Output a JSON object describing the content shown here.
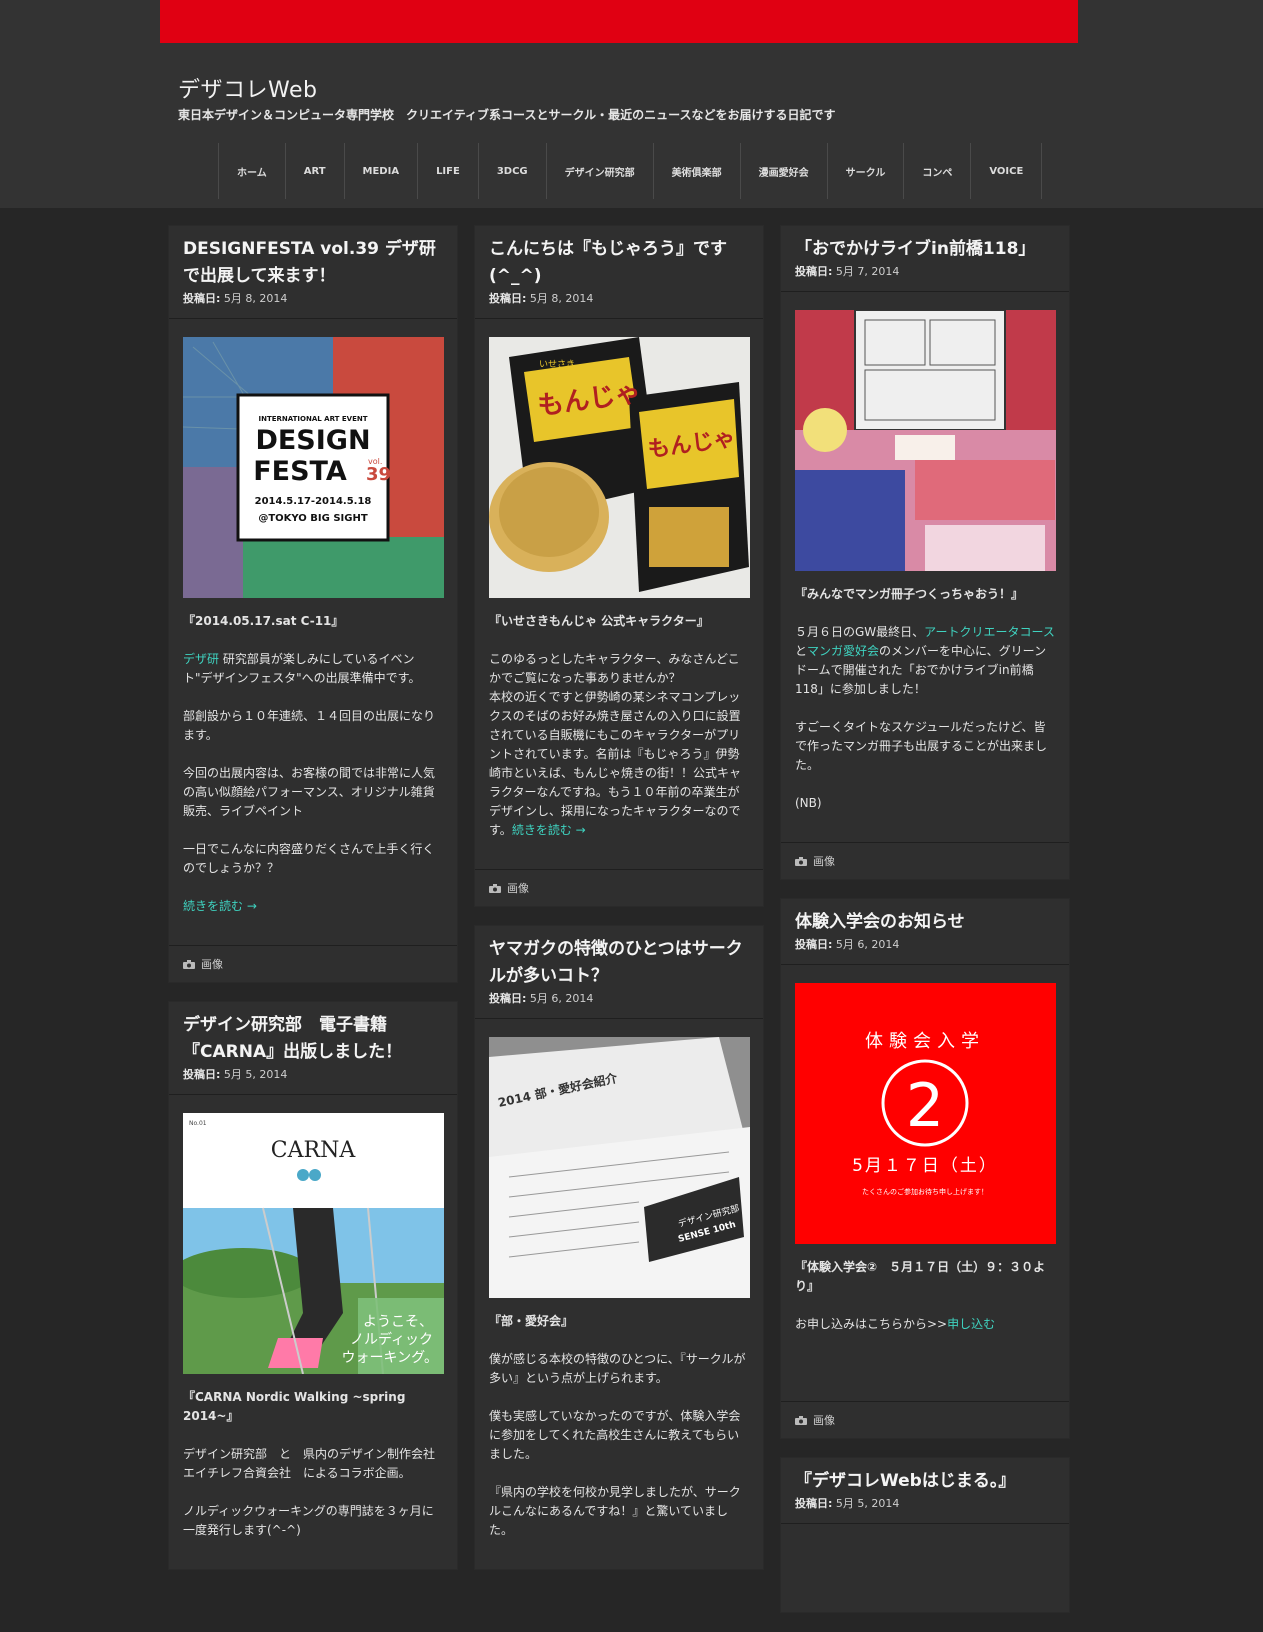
{
  "header": {
    "site_title": "デザコレWeb",
    "site_description": "東日本デザイン＆コンピュータ専門学校　クリエイティブ系コースとサークル・最近のニュースなどをお届けする日記です",
    "nav": [
      "ホーム",
      "ART",
      "MEDIA",
      "LIFE",
      "3DCG",
      "デザイン研究部",
      "美術俱楽部",
      "漫画愛好会",
      "サークル",
      "コンペ",
      "VOICE"
    ],
    "accent": "#e00012"
  },
  "labels": {
    "posted": "投稿日:",
    "format": "画像",
    "read_more": "続きを読む →"
  },
  "posts": {
    "p1": {
      "title": "DESIGNFESTA vol.39 デザ研で出展して来ます！",
      "date": "5月 8, 2014",
      "image_texts": [
        "INTERNATIONAL ART EVENT",
        "DESIGN",
        "FESTA",
        "vol.",
        "39",
        "2014.5.17-2014.5.18",
        "@TOKYO BIG SIGHT"
      ],
      "lead": "『2014.05.17.sat C-11』",
      "link_inline": "デザ研",
      "para1": " 研究部員が楽しみにしているイベント\"デザインフェスタ\"への出展準備中です。",
      "para2": "部創設から１０年連続、１４回目の出展になります。",
      "para3": "今回の出展内容は、お客様の間では非常に人気の高い似顔絵パフォーマンス、オリジナル雑貨販売、ライブペイント",
      "para4": "一日でこんなに内容盛りだくさんで上手く行くのでしょうか？？"
    },
    "p2": {
      "title": "デザイン研究部　電子書籍『CARNA』出版しました！",
      "date": "5月 5, 2014",
      "image_texts": [
        "CARNA",
        "No.01",
        "ようこそ、",
        "ノルディック",
        "ウォーキング。"
      ],
      "lead": "『CARNA Nordic Walking ~spring 2014~』",
      "para1": "デザイン研究部　と　県内のデザイン制作会社　エイチレフ合資会社　によるコラボ企画。",
      "para2": "ノルディックウォーキングの専門誌を３ヶ月に一度発行します(^-^)"
    },
    "p3": {
      "title": "こんにちは『もじゃろう』です(^_^)",
      "date": "5月 8, 2014",
      "image_texts": [
        "もんじゃ",
        "いせさき"
      ],
      "lead": "『いせさきもんじゃ 公式キャラクター』",
      "para1": "このゆるっとしたキャラクター、みなさんどこかでご覧になった事ありませんか？\n本校の近くですと伊勢崎の某シネマコンプレックスのそばのお好み焼き屋さんの入り口に設置されている自販機にもこのキャラクターがプリントされています。名前は『もじゃろう』伊勢崎市といえば、もんじゃ焼きの街！！公式キャラクターなんですね。もう１０年前の卒業生がデザインし、採用になったキャラクターなのです。"
    },
    "p4": {
      "title": "ヤマガクの特徴のひとつはサークルが多いコト？",
      "date": "5月 6, 2014",
      "image_texts": [
        "2014 部・愛好会紹介",
        "デザイン研究部",
        "SENSE 10th"
      ],
      "lead": "『部・愛好会』",
      "para1": "僕が感じる本校の特徴のひとつに、『サークルが多い』という点が上げられます。",
      "para2": "僕も実感していなかったのですが、体験入学会に参加をしてくれた高校生さんに教えてもらいました。",
      "para3": "『県内の学校を何校か見学しましたが、サークルこんなにあるんですね！』と驚いていました。"
    },
    "p5": {
      "title": "「おでかけライブin前橋118」",
      "date": "5月 7, 2014",
      "lead": "『みんなでマンガ冊子つくっちゃおう！』",
      "para1_a": "５月６日のGW最終日、",
      "link1": "アートクリエータコース",
      "para1_b": "と",
      "link2": "マンガ愛好会",
      "para1_c": "のメンバーを中心に、グリーンドームで開催された「おでかけライブin前橋118」に参加しました！",
      "para2": "すごーくタイトなスケジュールだったけど、皆で作ったマンガ冊子も出展することが出来ました。",
      "para3": "(NB)"
    },
    "p6": {
      "title": "体験入学会のお知らせ",
      "date": "5月 6, 2014",
      "image_texts": [
        "体験会入学",
        "2",
        "5月１７日（土）",
        "たくさんのご参加お待ち申し上げます！"
      ],
      "lead": "『体験入学会②　５月１７日（土）９：３０より』",
      "para1": "お申し込みはこちらから>>",
      "link": "申し込む"
    },
    "p7": {
      "title": "『デザコレWebはじまる。』",
      "date": "5月 5, 2014"
    }
  }
}
